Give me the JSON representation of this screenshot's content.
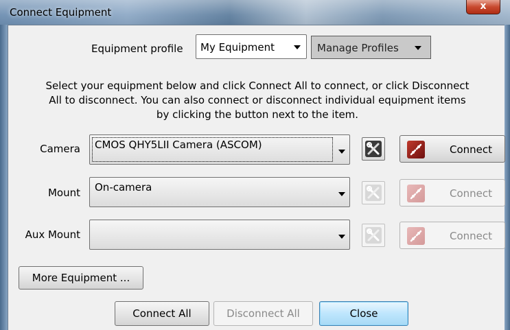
{
  "window": {
    "title": "Connect Equipment",
    "close_glyph": "x"
  },
  "profile": {
    "label": "Equipment profile",
    "selected": "My Equipment",
    "manage_label": "Manage Profiles"
  },
  "instructions": [
    "Select your equipment below and click Connect All to connect, or click Disconnect",
    "All to disconnect. You can also connect or disconnect individual equipment items",
    "by clicking the button next to the item."
  ],
  "devices": {
    "camera": {
      "label": "Camera",
      "selected": "CMOS QHY5LII Camera (ASCOM)",
      "connect_label": "Connect",
      "enabled": true
    },
    "mount": {
      "label": "Mount",
      "selected": "On-camera",
      "connect_label": "Connect",
      "enabled": false
    },
    "aux_mount": {
      "label": "Aux Mount",
      "selected": "",
      "connect_label": "Connect",
      "enabled": false
    }
  },
  "buttons": {
    "more_equipment": "More Equipment ...",
    "connect_all": "Connect All",
    "disconnect_all": "Disconnect All",
    "close": "Close"
  },
  "icons": {
    "setup": "tools-icon",
    "connect": "plug-icon",
    "dropdown": "chevron-down-icon"
  },
  "colors": {
    "dialog_bg": "#f0f0f0",
    "connect_icon_active": "#c0392b",
    "default_button": "#bee6fd"
  }
}
